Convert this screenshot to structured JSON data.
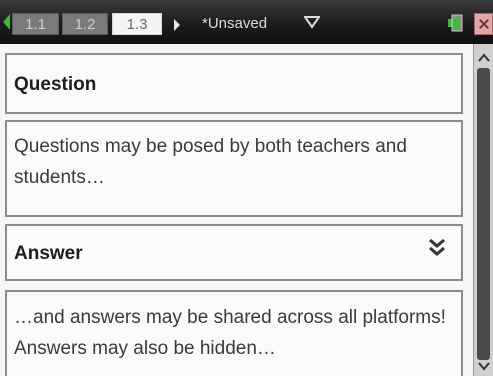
{
  "topbar": {
    "tabs": [
      {
        "label": "1.1",
        "active": false
      },
      {
        "label": "1.2",
        "active": false
      },
      {
        "label": "1.3",
        "active": true
      }
    ],
    "document_title": "*Unsaved",
    "icons": [
      "left-arrow-icon",
      "right-arrow-icon",
      "caret-down-icon",
      "battery-icon",
      "close-icon"
    ]
  },
  "question": {
    "heading": "Question",
    "body": "Questions may be posed by both teachers and students…"
  },
  "answer": {
    "heading": "Answer",
    "body": "…and answers may be shared across all platforms! Answers may also be hidden…",
    "expand_icon": "double-chevron-down-icon"
  },
  "colors": {
    "topbar_bg": "#1c1c1c",
    "active_tab_bg": "#f4f4f4",
    "arrow_green": "#3cba3c",
    "content_bg": "#f6f6f6",
    "border": "#8c8c8c"
  }
}
